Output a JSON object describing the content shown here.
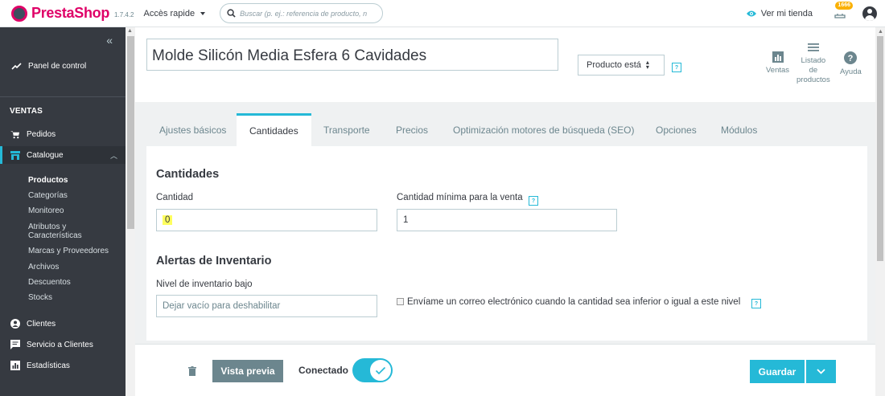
{
  "header": {
    "brand": "PrestaShop",
    "version": "1.7.4.2",
    "quick_access": "Accès rapide",
    "search_placeholder": "Buscar (p. ej.: referencia de producto, n",
    "view_shop": "Ver mi tienda",
    "notifications_count": "1666"
  },
  "sidebar": {
    "dashboard": "Panel de control",
    "section_title": "VENTAS",
    "items": [
      {
        "label": "Pedidos",
        "icon": "cart-icon"
      },
      {
        "label": "Catalogue",
        "icon": "store-icon"
      }
    ],
    "catalogue_sub": [
      "Productos",
      "Categorías",
      "Monitoreo",
      "Atributos y",
      "Características",
      "Marcas y Proveedores",
      "Archivos",
      "Descuentos",
      "Stocks"
    ],
    "bottom_items": [
      {
        "label": "Clientes",
        "icon": "user-icon"
      },
      {
        "label": "Servicio a Clientes",
        "icon": "chat-icon"
      },
      {
        "label": "Estadísticas",
        "icon": "stats-icon"
      }
    ]
  },
  "product": {
    "name": "Molde Silicón Media Esfera 6 Cavidades",
    "status_select": "Producto está",
    "toolbar": {
      "sales": "Ventas",
      "list_line1": "Listado",
      "list_line2": "de",
      "list_line3": "productos",
      "help": "Ayuda"
    }
  },
  "tabs": [
    "Ajustes básicos",
    "Cantidades",
    "Transporte",
    "Precios",
    "Optimización motores de búsqueda (SEO)",
    "Opciones",
    "Módulos"
  ],
  "form": {
    "quantities_title": "Cantidades",
    "quantity_label": "Cantidad",
    "quantity_value": "0",
    "min_qty_label": "Cantidad mínima para la venta",
    "min_qty_value": "1",
    "alerts_title": "Alertas de Inventario",
    "low_stock_label": "Nivel de inventario bajo",
    "low_stock_placeholder": "Dejar vacío para deshabilitar",
    "email_checkbox_label": "Envíame un correo electrónico cuando la cantidad sea inferior o igual a este nivel",
    "help_mark": "?"
  },
  "footer": {
    "preview": "Vista previa",
    "online_label": "Conectado",
    "online": true,
    "save": "Guardar"
  },
  "colors": {
    "accent": "#25b9d7",
    "brand": "#df0067",
    "sidebar_bg": "#363a41",
    "highlight": "#ffff5e"
  }
}
